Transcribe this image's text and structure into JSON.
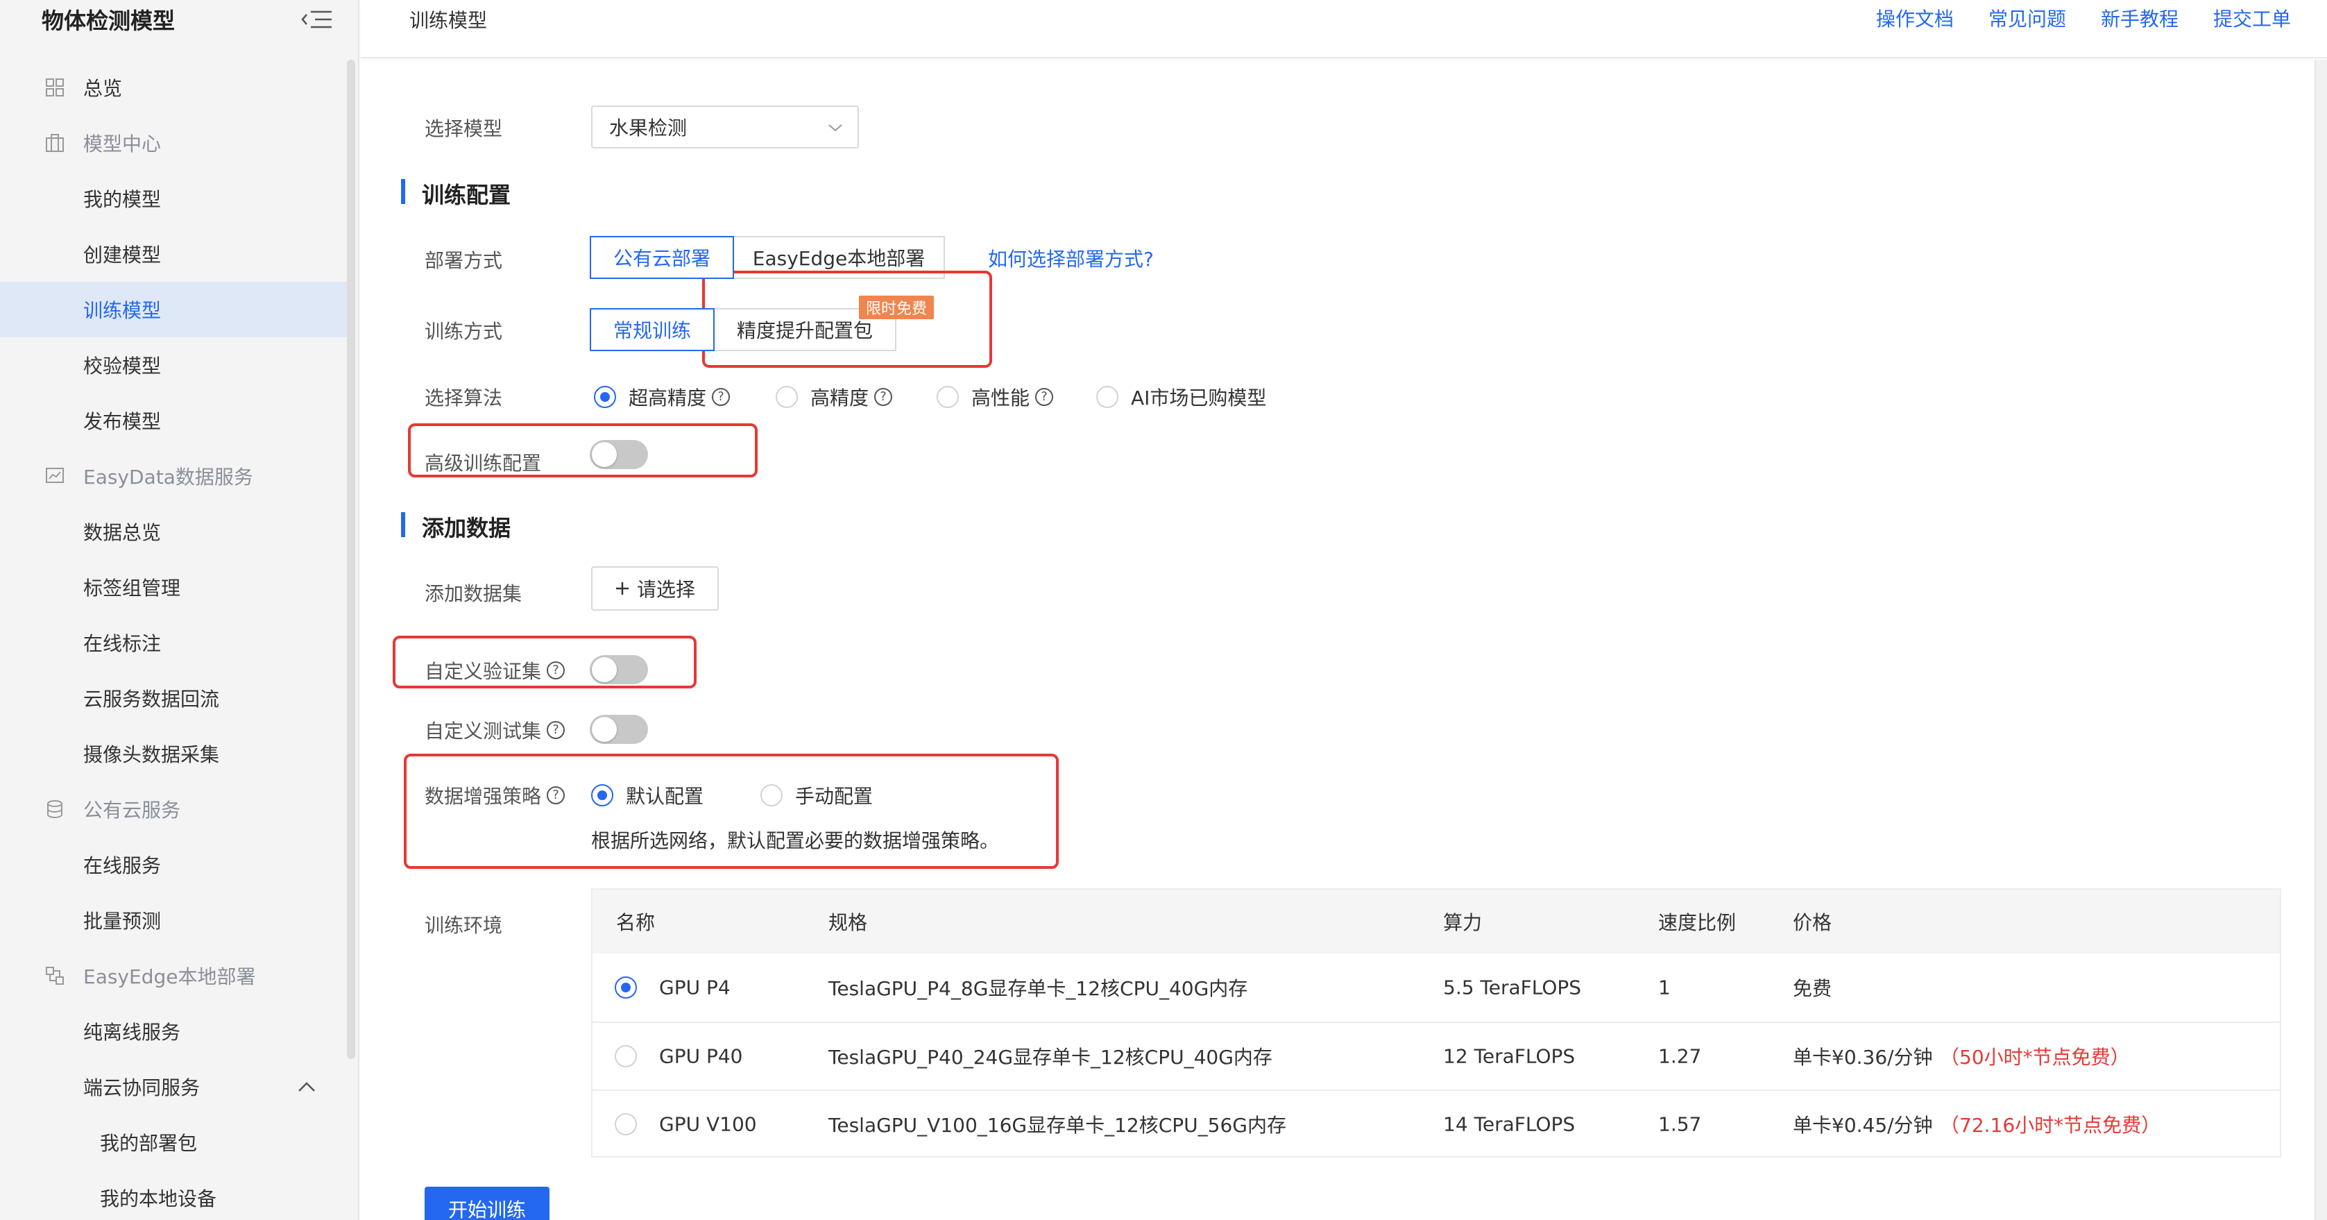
{
  "sidebar": {
    "title": "物体检测模型",
    "items": [
      {
        "label": "总览",
        "type": "group",
        "icon": "grid-icon"
      },
      {
        "label": "模型中心",
        "type": "group",
        "icon": "building-icon"
      },
      {
        "label": "我的模型",
        "type": "sub"
      },
      {
        "label": "创建模型",
        "type": "sub"
      },
      {
        "label": "训练模型",
        "type": "sub",
        "active": true
      },
      {
        "label": "校验模型",
        "type": "sub"
      },
      {
        "label": "发布模型",
        "type": "sub"
      },
      {
        "label": "EasyData数据服务",
        "type": "group",
        "icon": "chart-icon"
      },
      {
        "label": "数据总览",
        "type": "sub"
      },
      {
        "label": "标签组管理",
        "type": "sub"
      },
      {
        "label": "在线标注",
        "type": "sub"
      },
      {
        "label": "云服务数据回流",
        "type": "sub"
      },
      {
        "label": "摄像头数据采集",
        "type": "sub"
      },
      {
        "label": "公有云服务",
        "type": "group",
        "icon": "database-icon"
      },
      {
        "label": "在线服务",
        "type": "sub"
      },
      {
        "label": "批量预测",
        "type": "sub"
      },
      {
        "label": "EasyEdge本地部署",
        "type": "group",
        "icon": "edge-icon"
      },
      {
        "label": "纯离线服务",
        "type": "sub"
      },
      {
        "label": "端云协同服务",
        "type": "sub",
        "expanded": true
      },
      {
        "label": "我的部署包",
        "type": "sub3"
      },
      {
        "label": "我的本地设备",
        "type": "sub3"
      }
    ]
  },
  "topbar": {
    "title": "训练模型",
    "links": [
      "操作文档",
      "常见问题",
      "新手教程",
      "提交工单"
    ]
  },
  "form": {
    "select_model_label": "选择模型",
    "select_model_value": "水果检测",
    "section_train": "训练配置",
    "deploy_label": "部署方式",
    "deploy_options": [
      "公有云部署",
      "EasyEdge本地部署"
    ],
    "deploy_help_link": "如何选择部署方式?",
    "train_method_label": "训练方式",
    "train_methods": [
      "常规训练",
      "精度提升配置包"
    ],
    "limited_free_badge": "限时免费",
    "algorithm_label": "选择算法",
    "algorithms": [
      "超高精度",
      "高精度",
      "高性能",
      "AI市场已购模型"
    ],
    "advanced_label": "高级训练配置",
    "section_data": "添加数据",
    "add_dataset_label": "添加数据集",
    "add_dataset_button": "请选择",
    "custom_val_label": "自定义验证集",
    "custom_test_label": "自定义测试集",
    "augment_label": "数据增强策略",
    "augment_options": [
      "默认配置",
      "手动配置"
    ],
    "augment_desc": "根据所选网络，默认配置必要的数据增强策略。",
    "env_label": "训练环境",
    "help_glyph": "?"
  },
  "table": {
    "headers": [
      "名称",
      "规格",
      "算力",
      "速度比例",
      "价格"
    ],
    "rows": [
      {
        "name": "GPU P4",
        "spec": "TeslaGPU_P4_8G显存单卡_12核CPU_40G内存",
        "power": "5.5 TeraFLOPS",
        "ratio": "1",
        "price": "免费",
        "promo": "",
        "selected": true
      },
      {
        "name": "GPU P40",
        "spec": "TeslaGPU_P40_24G显存单卡_12核CPU_40G内存",
        "power": "12 TeraFLOPS",
        "ratio": "1.27",
        "price": "单卡¥0.36/分钟",
        "promo": "（50小时*节点免费）",
        "selected": false
      },
      {
        "name": "GPU V100",
        "spec": "TeslaGPU_V100_16G显存单卡_12核CPU_56G内存",
        "power": "14 TeraFLOPS",
        "ratio": "1.57",
        "price": "单卡¥0.45/分钟",
        "promo": "（72.16小时*节点免费）",
        "selected": false
      }
    ]
  },
  "start_button": "开始训练",
  "colors": {
    "accent": "#2468f2",
    "highlight_box": "#e53935",
    "badge": "#f0864f"
  }
}
